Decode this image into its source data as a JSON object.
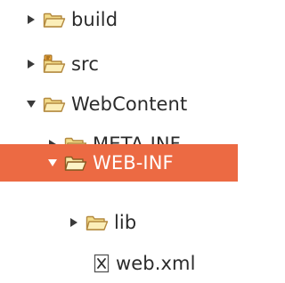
{
  "tree": {
    "items": [
      {
        "label": "build",
        "depth": 1,
        "expanded": false,
        "icon": "folder-icon",
        "selected": false
      },
      {
        "label": "src",
        "depth": 1,
        "expanded": false,
        "icon": "source-folder-icon",
        "selected": false
      },
      {
        "label": "WebContent",
        "depth": 1,
        "expanded": true,
        "icon": "folder-icon",
        "selected": false
      },
      {
        "label": "META-INF",
        "depth": 2,
        "expanded": false,
        "icon": "folder-icon",
        "selected": false
      },
      {
        "label": "WEB-INF",
        "depth": 2,
        "expanded": true,
        "icon": "folder-icon",
        "selected": true
      },
      {
        "label": "lib",
        "depth": 3,
        "expanded": false,
        "icon": "folder-icon",
        "selected": false
      },
      {
        "label": "web.xml",
        "depth": 3,
        "expanded": null,
        "icon": "xml-file-icon",
        "selected": false
      }
    ]
  },
  "colors": {
    "selection": "#ec6a43",
    "folder_fill": "#f6e39a",
    "folder_stroke": "#b3893f",
    "arrow": "#3a3a3a"
  }
}
